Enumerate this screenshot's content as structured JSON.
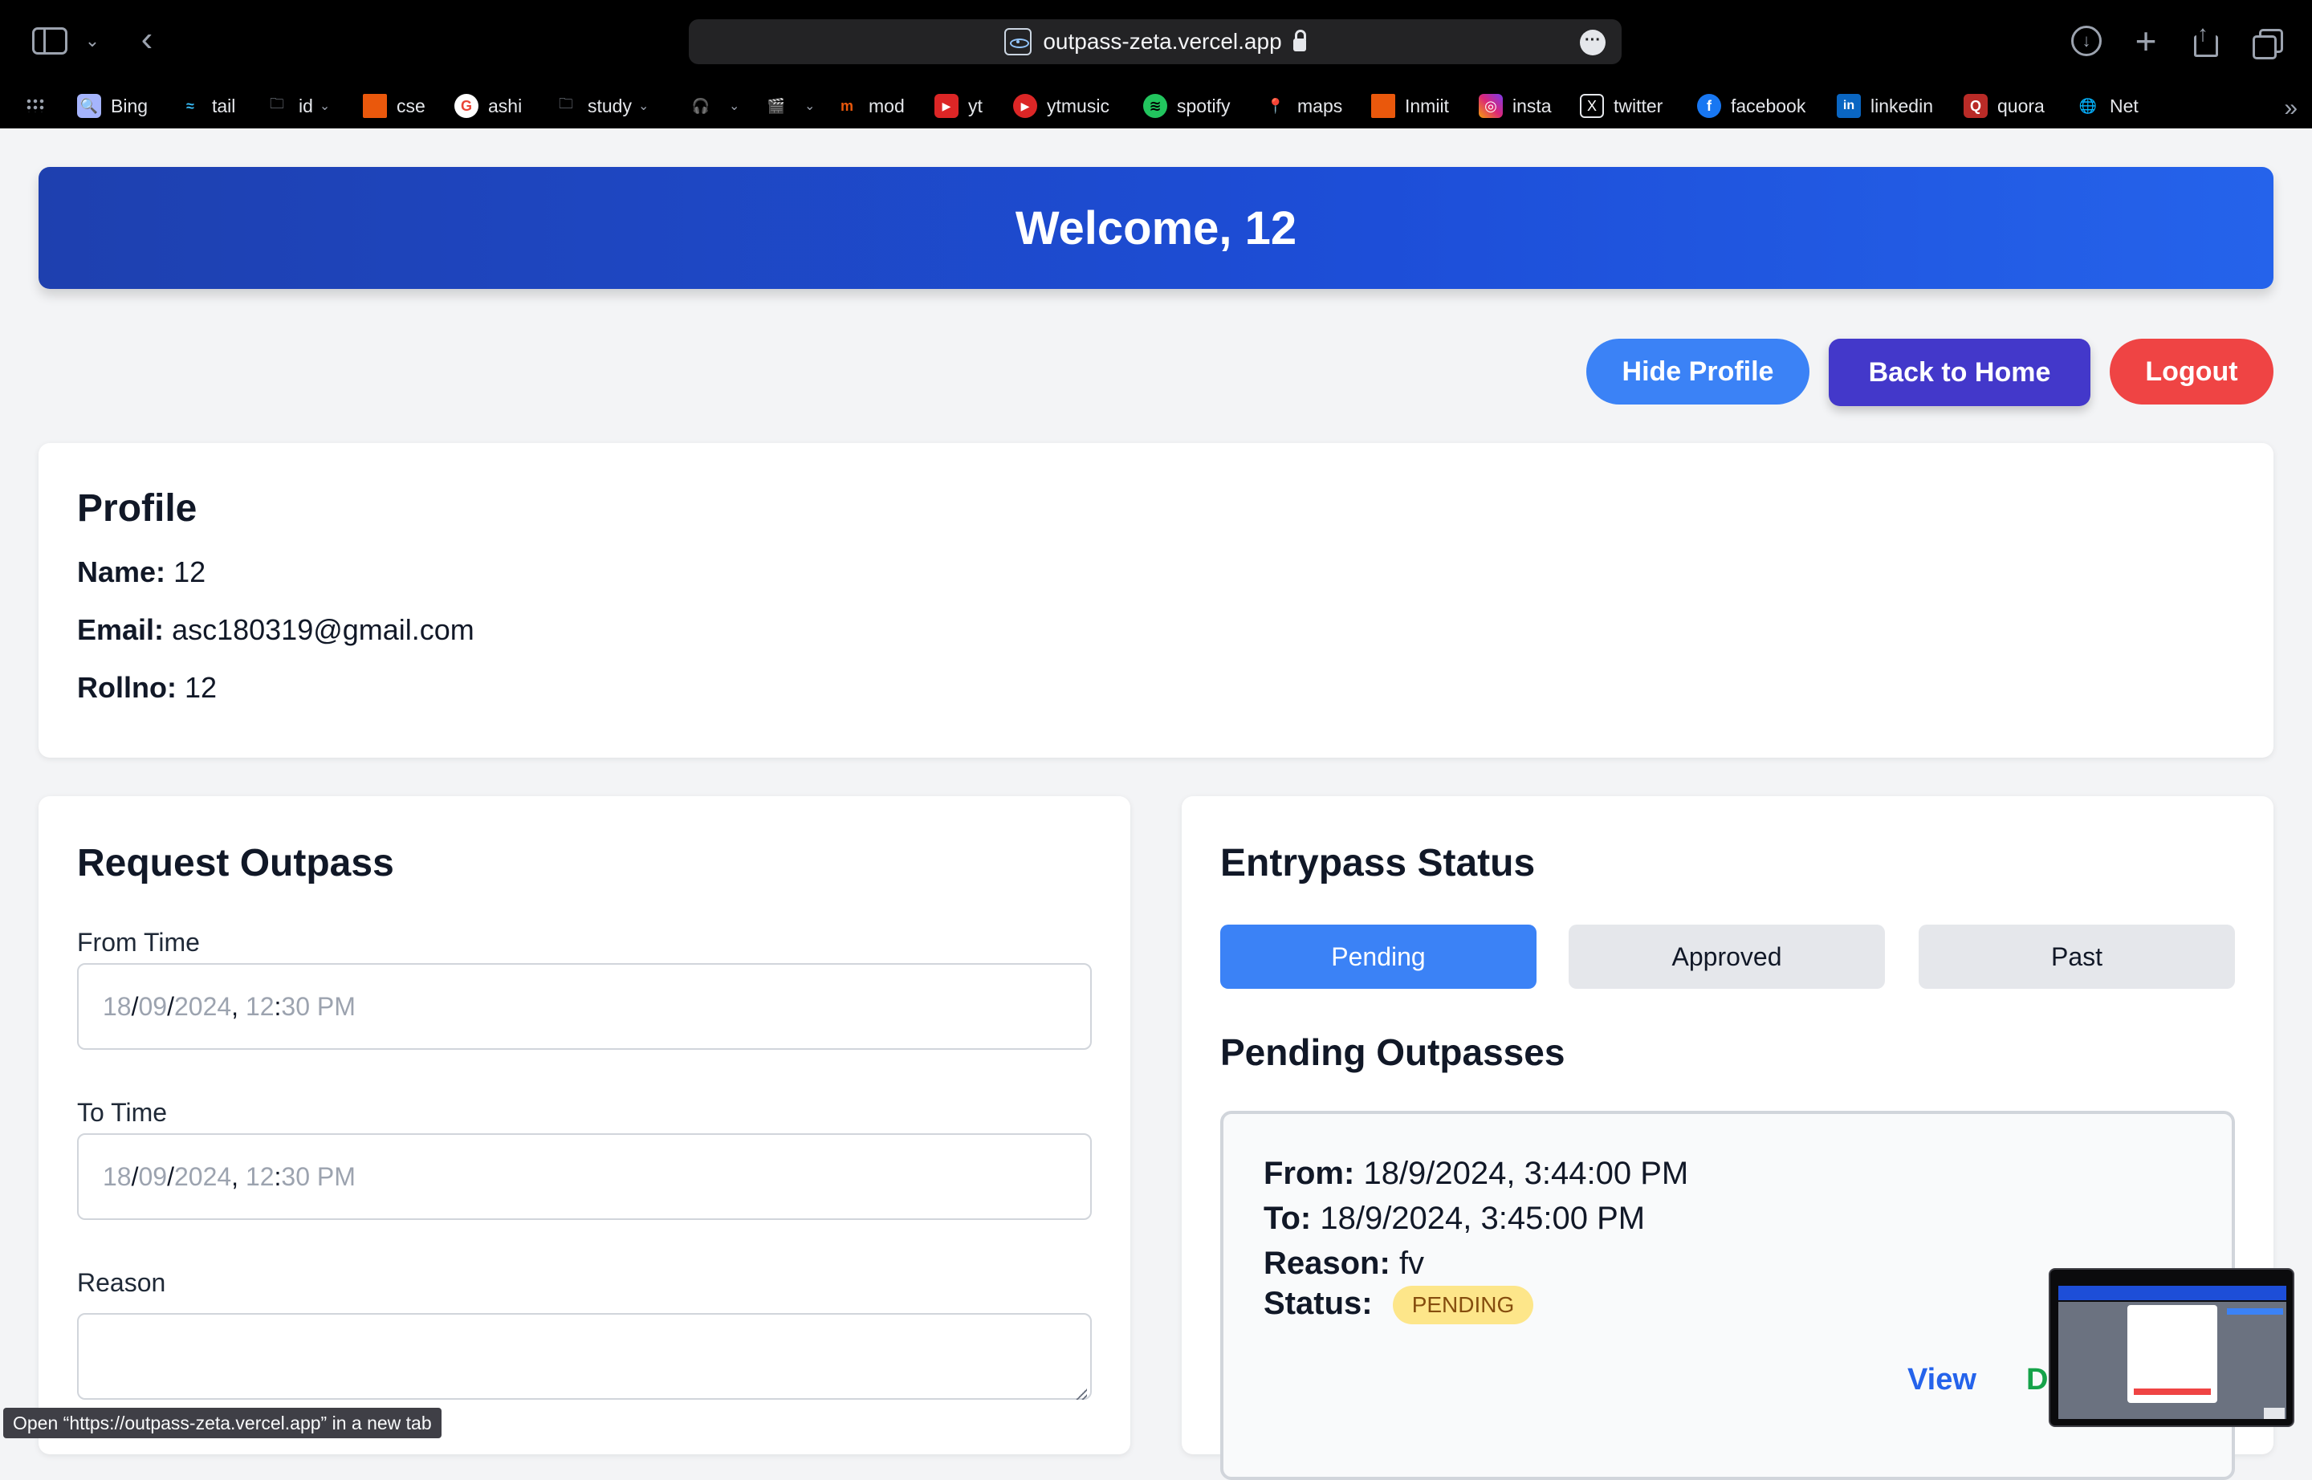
{
  "browser": {
    "url": "outpass-zeta.vercel.app",
    "bookmarks": [
      {
        "label": "Bing"
      },
      {
        "label": "tail"
      },
      {
        "label": "id"
      },
      {
        "label": "cse"
      },
      {
        "label": "ashi"
      },
      {
        "label": "study"
      },
      {
        "label": ""
      },
      {
        "label": ""
      },
      {
        "label": "mod"
      },
      {
        "label": "yt"
      },
      {
        "label": "ytmusic"
      },
      {
        "label": "spotify"
      },
      {
        "label": "maps"
      },
      {
        "label": "Inmiit"
      },
      {
        "label": "insta"
      },
      {
        "label": "twitter"
      },
      {
        "label": "facebook"
      },
      {
        "label": "linkedin"
      },
      {
        "label": "quora"
      },
      {
        "label": "Net"
      }
    ],
    "status_tooltip": "Open “https://outpass-zeta.vercel.app” in a new tab"
  },
  "header": {
    "welcome": "Welcome, 12"
  },
  "actions": {
    "hide_profile": "Hide Profile",
    "back_home": "Back to Home",
    "logout": "Logout"
  },
  "profile": {
    "title": "Profile",
    "name_label": "Name:",
    "name": "12",
    "email_label": "Email:",
    "email": "asc180319@gmail.com",
    "rollno_label": "Rollno:",
    "rollno": "12"
  },
  "request": {
    "title": "Request Outpass",
    "from_label": "From Time",
    "from_value": {
      "d": "18",
      "m": "09",
      "y": "2024",
      "h": "12",
      "rest": "30 PM"
    },
    "to_label": "To Time",
    "to_value": {
      "d": "18",
      "m": "09",
      "y": "2024",
      "h": "12",
      "rest": "30 PM"
    },
    "reason_label": "Reason"
  },
  "status": {
    "title": "Entrypass Status",
    "tabs": [
      "Pending",
      "Approved",
      "Past"
    ],
    "list_title": "Pending Outpasses",
    "item": {
      "from_label": "From:",
      "from": "18/9/2024, 3:44:00 PM",
      "to_label": "To:",
      "to": "18/9/2024, 3:45:00 PM",
      "reason_label": "Reason:",
      "reason": "fv",
      "status_label": "Status:",
      "status": "PENDING",
      "view": "View",
      "download": "Dow"
    }
  },
  "colors": {
    "header_blue": "#1d4ed8",
    "hide_profile": "#3b82f6",
    "back_home": "#4338ca",
    "logout": "#ef4444",
    "pending_badge": "#fde68a",
    "download_green": "#16a34a"
  }
}
